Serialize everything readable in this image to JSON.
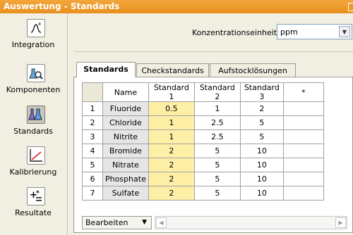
{
  "window": {
    "title": "Auswertung - Standards"
  },
  "sidebar": {
    "items": [
      {
        "label": "Integration",
        "icon": "integration-icon"
      },
      {
        "label": "Komponenten",
        "icon": "komponenten-icon"
      },
      {
        "label": "Standards",
        "icon": "standards-icon",
        "active": true
      },
      {
        "label": "Kalibrierung",
        "icon": "kalibrierung-icon"
      },
      {
        "label": "Resultate",
        "icon": "resultate-icon"
      }
    ]
  },
  "concentration": {
    "label": "Konzentrationseinheit",
    "value": "ppm"
  },
  "tabs": [
    {
      "label": "Standards",
      "active": true
    },
    {
      "label": "Checkstandards"
    },
    {
      "label": "Aufstocklösungen"
    }
  ],
  "table": {
    "headers": [
      "",
      "Name",
      "Standard 1",
      "Standard 2",
      "Standard 3",
      "*"
    ],
    "rows": [
      [
        "1",
        "Fluoride",
        "0.5",
        "1",
        "2",
        ""
      ],
      [
        "2",
        "Chloride",
        "1",
        "2.5",
        "5",
        ""
      ],
      [
        "3",
        "Nitrite",
        "1",
        "2.5",
        "5",
        ""
      ],
      [
        "4",
        "Bromide",
        "2",
        "5",
        "10",
        ""
      ],
      [
        "5",
        "Nitrate",
        "2",
        "5",
        "10",
        ""
      ],
      [
        "6",
        "Phosphate",
        "2",
        "5",
        "10",
        ""
      ],
      [
        "7",
        "Sulfate",
        "2",
        "5",
        "10",
        ""
      ]
    ]
  },
  "bottom": {
    "edit_label": "Bearbeiten"
  }
}
